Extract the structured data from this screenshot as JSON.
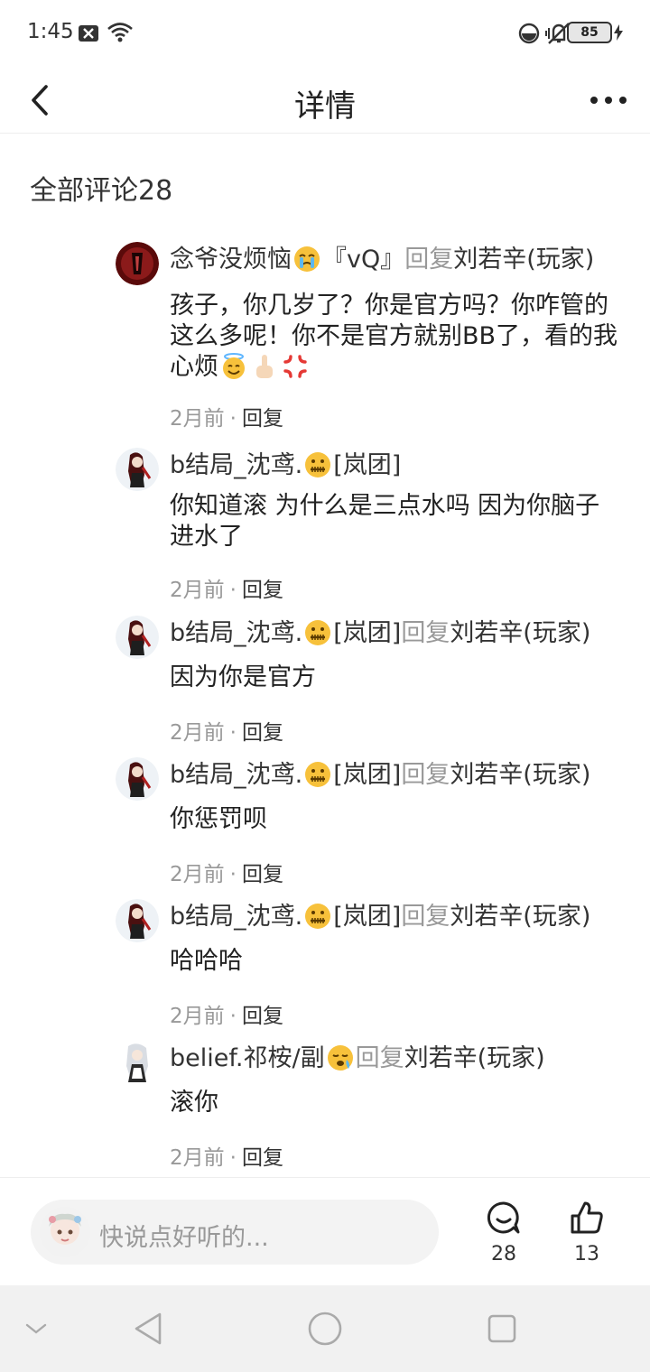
{
  "status_bar": {
    "time": "1:45",
    "battery": "85"
  },
  "header": {
    "title": "详情"
  },
  "comments_header": "全部评论28",
  "comments": [
    {
      "user": "念爷没烦恼",
      "user_suffix": "『vQ』",
      "reply_word": "回复",
      "target": "刘若辛(玩家)",
      "body": "孩子，你几岁了？你是官方吗？你咋管的这么多呢！你不是官方就别BB了，看的我心烦",
      "time": "2月前",
      "reply_label": "回复"
    },
    {
      "user": "b结局_沈鸢.",
      "user_suffix": "[岚团]",
      "reply_word": "",
      "target": "",
      "body": "你知道滚 为什么是三点水吗 因为你脑子进水了",
      "time": "2月前",
      "reply_label": "回复"
    },
    {
      "user": "b结局_沈鸢.",
      "user_suffix": "[岚团]",
      "reply_word": "回复",
      "target": "刘若辛(玩家)",
      "body": "因为你是官方",
      "time": "2月前",
      "reply_label": "回复"
    },
    {
      "user": "b结局_沈鸢.",
      "user_suffix": "[岚团]",
      "reply_word": "回复",
      "target": "刘若辛(玩家)",
      "body": "你惩罚呗",
      "time": "2月前",
      "reply_label": "回复"
    },
    {
      "user": "b结局_沈鸢.",
      "user_suffix": "[岚团]",
      "reply_word": "回复",
      "target": "刘若辛(玩家)",
      "body": "哈哈哈",
      "time": "2月前",
      "reply_label": "回复"
    },
    {
      "user": "belief.祁桉/副",
      "user_suffix": "",
      "reply_word": "回复",
      "target": "刘若辛(玩家)",
      "body": "滚你",
      "time": "2月前",
      "reply_label": "回复"
    }
  ],
  "input_bar": {
    "placeholder": "快说点好听的...",
    "comment_count": "28",
    "like_count": "13"
  },
  "colors": {
    "muted": "#999999",
    "text": "#222222",
    "nav_bg": "#f1f1f1"
  }
}
